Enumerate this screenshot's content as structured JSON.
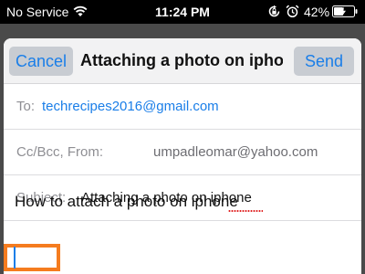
{
  "status_bar": {
    "carrier": "No Service",
    "time": "11:24 PM",
    "battery": "42%",
    "icons": [
      "wifi-icon",
      "orientation-lock-icon",
      "alarm-icon",
      "battery-icon"
    ]
  },
  "compose": {
    "cancel_label": "Cancel",
    "title": "Attaching a photo on iphone",
    "send_label": "Send",
    "to_label": "To:",
    "to_value": "techrecipes2016@gmail.com",
    "cc_label": "Cc/Bcc, From:",
    "cc_value": "umpadleomar@yahoo.com",
    "subject_label": "Subject:",
    "subject_value": "Attaching a photo on iphone",
    "body": "How to attach a photo on iphone"
  },
  "colors": {
    "accent": "#1a7ee8",
    "highlight": "#f57c1f",
    "spellcheck": "#e02020"
  }
}
